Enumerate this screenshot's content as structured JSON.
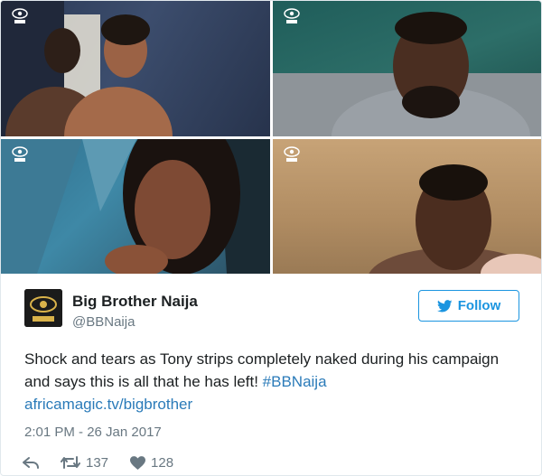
{
  "tweet": {
    "author": {
      "name": "Big Brother Naija",
      "handle": "@BBNaija",
      "avatar_icon": "bbnaija-eye-logo"
    },
    "follow_label": "Follow",
    "text_plain": "Shock and tears as Tony strips completely naked during his campaign and says this is all that he has left! ",
    "hashtag": "#BBNaija",
    "link": "africamagic.tv/bigbrother",
    "timestamp": "2:01 PM - 26 Jan 2017",
    "retweets": "137",
    "likes": "128"
  },
  "photos": [
    {
      "icon": "bbnaija-watermark-icon"
    },
    {
      "icon": "bbnaija-watermark-icon"
    },
    {
      "icon": "bbnaija-watermark-icon"
    },
    {
      "icon": "bbnaija-watermark-icon"
    }
  ],
  "colors": {
    "link": "#2b7bb9",
    "follow": "#1b95e0",
    "muted": "#697882",
    "text": "#1c2022"
  }
}
